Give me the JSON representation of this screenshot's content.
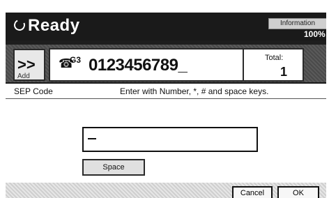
{
  "status": {
    "text": "Ready",
    "information_label": "Information",
    "percent": "100%"
  },
  "add_button": {
    "arrows": ">>",
    "label": "Add"
  },
  "destination": {
    "line_label": "G3",
    "number": "0123456789_"
  },
  "total": {
    "label": "Total:",
    "value": "1"
  },
  "dialog": {
    "title": "SEP Code",
    "instruction": "Enter with Number, *, # and space keys.",
    "input_value": "_",
    "space_label": "Space",
    "cancel_label": "Cancel",
    "ok_label": "OK"
  }
}
